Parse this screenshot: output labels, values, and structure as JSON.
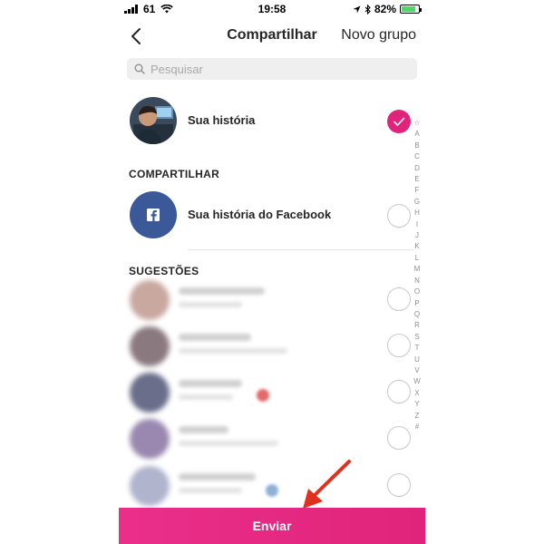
{
  "status_bar": {
    "carrier": "61",
    "time": "19:58",
    "battery": "82%",
    "battery_level": 0.82
  },
  "nav": {
    "title": "Compartilhar",
    "action": "Novo grupo"
  },
  "search": {
    "placeholder": "Pesquisar"
  },
  "story_row": {
    "label": "Sua história",
    "selected": true
  },
  "share_section": {
    "title": "COMPARTILHAR",
    "facebook_label": "Sua história do Facebook",
    "selected": false
  },
  "suggestions": {
    "title": "SUGESTÕES",
    "count_visible": 5
  },
  "alphabet_index": [
    "☆",
    "A",
    "B",
    "C",
    "D",
    "E",
    "F",
    "G",
    "H",
    "I",
    "J",
    "K",
    "L",
    "M",
    "N",
    "O",
    "P",
    "Q",
    "R",
    "S",
    "T",
    "U",
    "V",
    "W",
    "X",
    "Y",
    "Z",
    "#"
  ],
  "send_button": {
    "label": "Enviar"
  },
  "colors": {
    "accent": "#e0247b",
    "facebook": "#3b5998",
    "annotation_arrow": "#e0301e"
  }
}
